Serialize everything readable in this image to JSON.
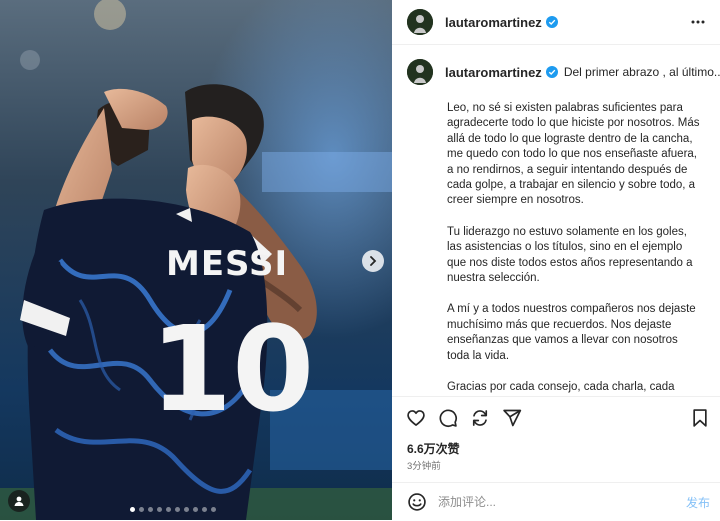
{
  "photo": {
    "jersey_name": "MESSI",
    "jersey_number": "10",
    "next_icon": "chevron-right-icon",
    "user_tag_icon": "user-tag-icon",
    "carousel_dots": 10,
    "active_dot": 0
  },
  "header": {
    "username": "lautaromartinez",
    "verified_icon": "verified-badge-icon",
    "more_icon": "more-horizontal-icon"
  },
  "caption": {
    "username": "lautaromartinez",
    "first_line": "Del primer abrazo , al último..",
    "paragraphs": [
      "Leo, no sé si existen palabras suficientes para agradecerte todo lo que hiciste por nosotros. Más allá de todo lo que lograste dentro de la cancha, me quedo con todo lo que nos enseñaste afuera, a no rendirnos, a seguir intentando después de cada golpe, a trabajar en silencio y sobre todo, a creer siempre en nosotros.",
      "Tu liderazgo no estuvo solamente en los goles, las asistencias o los títulos, sino en el ejemplo que nos diste todos estos años representando a nuestra selección.",
      "A mí y a todos nuestros compañeros nos dejaste muchísimo más que recuerdos. Nos dejaste enseñanzas que vamos a llevar con nosotros toda la vida.",
      "Gracias por cada consejo, cada charla, cada entrenamiento, cada abrazo y cada momento"
    ]
  },
  "actions": {
    "like_icon": "heart-icon",
    "comment_icon": "comment-icon",
    "share_icon": "repost-icon",
    "send_icon": "send-icon",
    "save_icon": "bookmark-icon"
  },
  "likes": "6.6万次赞",
  "time": "3分钟前",
  "comment": {
    "emoji_icon": "emoji-icon",
    "placeholder": "添加评论...",
    "value": "",
    "post_label": "发布"
  },
  "colors": {
    "verified": "#1d9bf0",
    "post_button": "#85c1f7",
    "jersey_dark": "#0f1a33",
    "jersey_pattern": "#3a7bd5"
  }
}
